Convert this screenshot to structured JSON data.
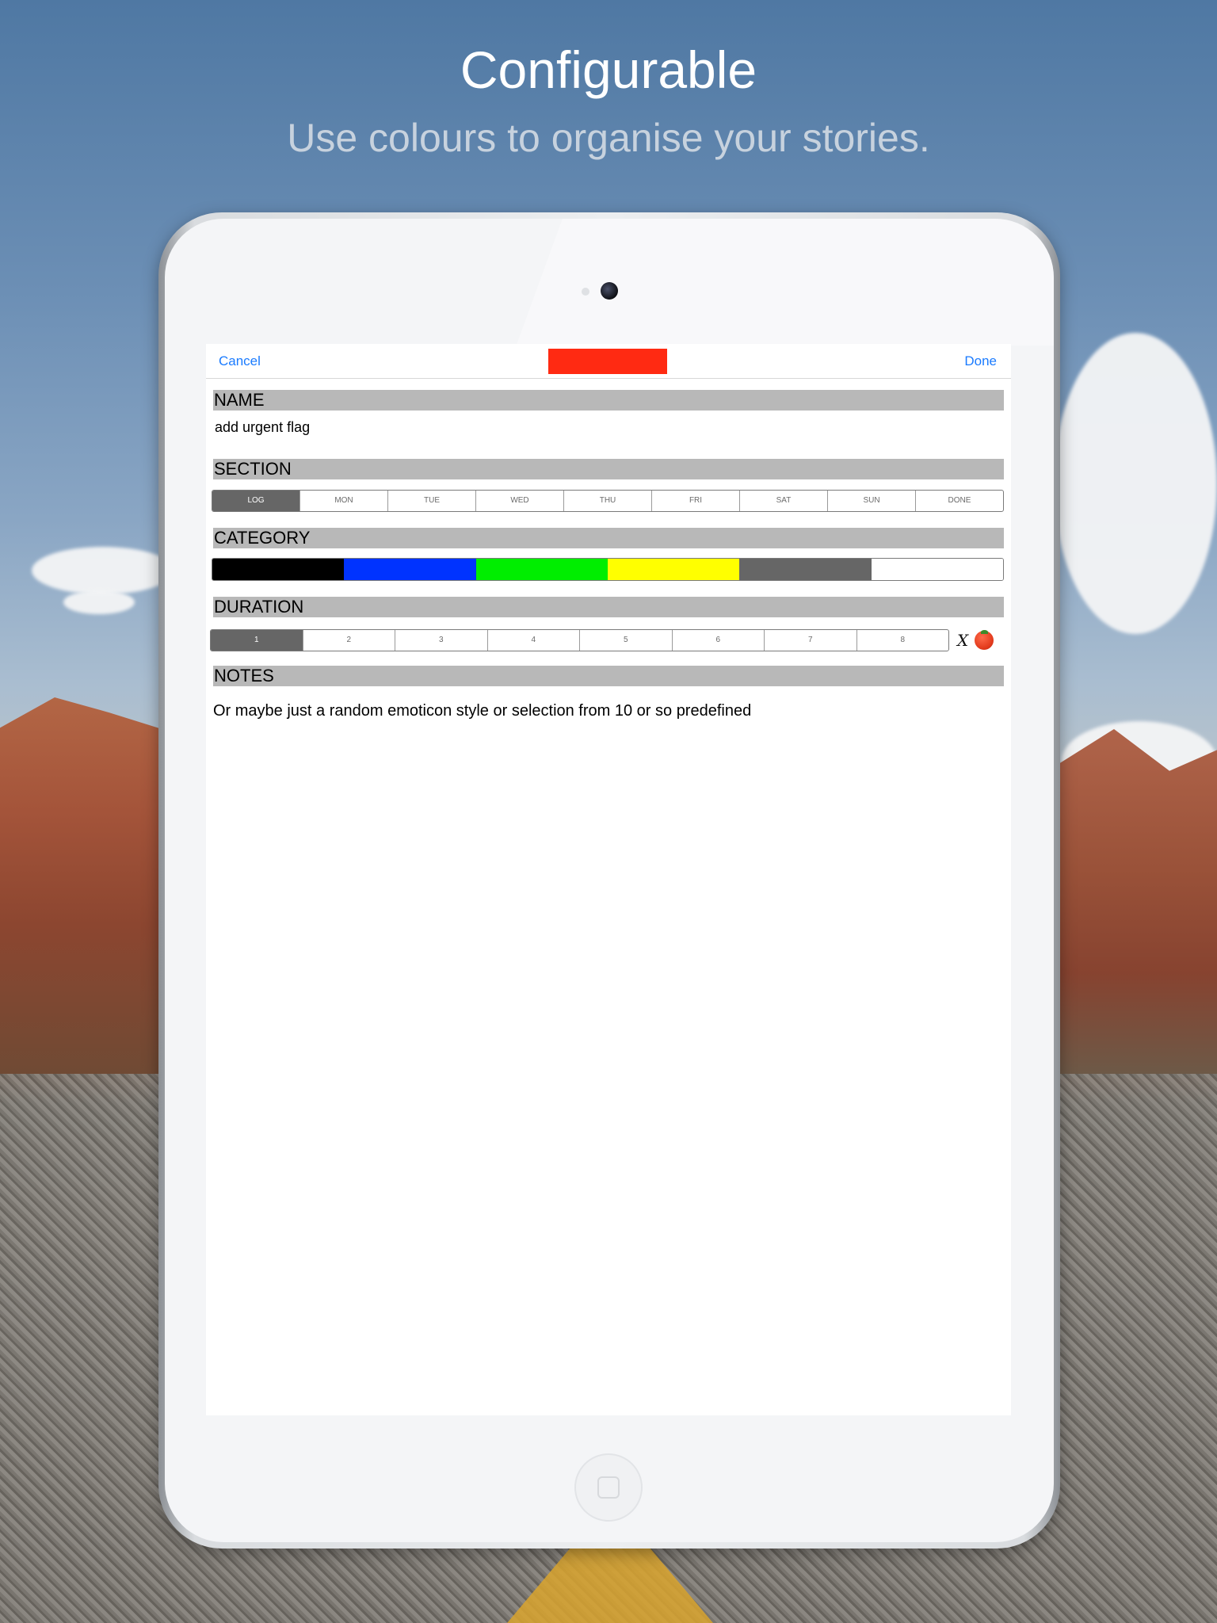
{
  "headline": {
    "title": "Configurable",
    "subtitle": "Use colours to organise your stories."
  },
  "navbar": {
    "cancel_label": "Cancel",
    "done_label": "Done",
    "flag_color": "#ff2a12"
  },
  "form": {
    "name": {
      "header": "NAME",
      "value": "add urgent flag"
    },
    "section": {
      "header": "SECTION",
      "options": [
        "LOG",
        "MON",
        "TUE",
        "WED",
        "THU",
        "FRI",
        "SAT",
        "SUN",
        "DONE"
      ],
      "selected": "LOG"
    },
    "category": {
      "header": "CATEGORY",
      "colors": [
        "#000000",
        "#0033ff",
        "#00ee00",
        "#ffff00",
        "#666666",
        "#ffffff"
      ]
    },
    "duration": {
      "header": "DURATION",
      "options": [
        "1",
        "2",
        "3",
        "4",
        "5",
        "6",
        "7",
        "8"
      ],
      "selected": "1",
      "clear_symbol": "X",
      "timer_icon": "tomato-icon"
    },
    "notes": {
      "header": "NOTES",
      "value": "Or maybe just a random emoticon style or selection from 10 or so predefined"
    }
  }
}
